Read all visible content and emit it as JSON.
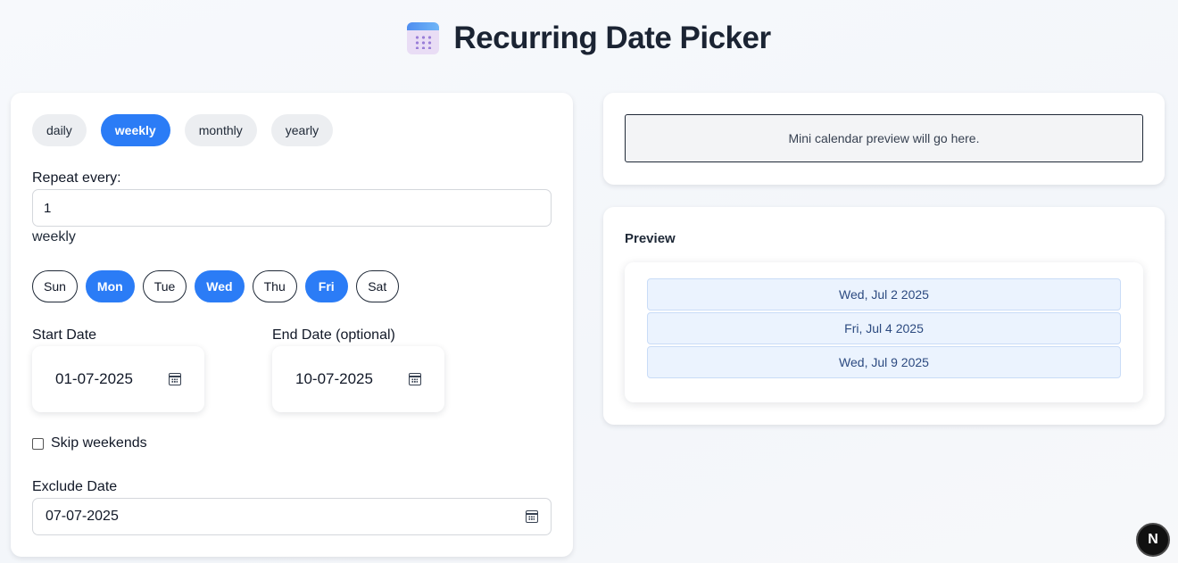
{
  "header": {
    "icon": "calendar-icon",
    "title": "Recurring Date Picker"
  },
  "frequency": {
    "tabs": [
      {
        "label": "daily",
        "active": false
      },
      {
        "label": "weekly",
        "active": true
      },
      {
        "label": "monthly",
        "active": false
      },
      {
        "label": "yearly",
        "active": false
      }
    ]
  },
  "repeat": {
    "label": "Repeat every:",
    "value": "1",
    "unit": "weekly"
  },
  "weekdays": [
    {
      "label": "Sun",
      "selected": false
    },
    {
      "label": "Mon",
      "selected": true
    },
    {
      "label": "Tue",
      "selected": false
    },
    {
      "label": "Wed",
      "selected": true
    },
    {
      "label": "Thu",
      "selected": false
    },
    {
      "label": "Fri",
      "selected": true
    },
    {
      "label": "Sat",
      "selected": false
    }
  ],
  "start_date": {
    "label": "Start Date",
    "value": "01-07-2025"
  },
  "end_date": {
    "label": "End Date (optional)",
    "value": "10-07-2025"
  },
  "skip_weekends": {
    "label": "Skip weekends",
    "checked": false
  },
  "exclude": {
    "label": "Exclude Date",
    "value": "07-07-2025"
  },
  "mini_calendar": {
    "placeholder": "Mini calendar preview will go here."
  },
  "preview": {
    "title": "Preview",
    "dates": [
      "Wed, Jul 2 2025",
      "Fri, Jul 4 2025",
      "Wed, Jul 9 2025"
    ]
  },
  "dev_badge": {
    "label": "N"
  },
  "colors": {
    "accent": "#2b7cf6",
    "preview_item_bg": "#ebf3fe",
    "preview_item_text": "#2c4a80"
  }
}
